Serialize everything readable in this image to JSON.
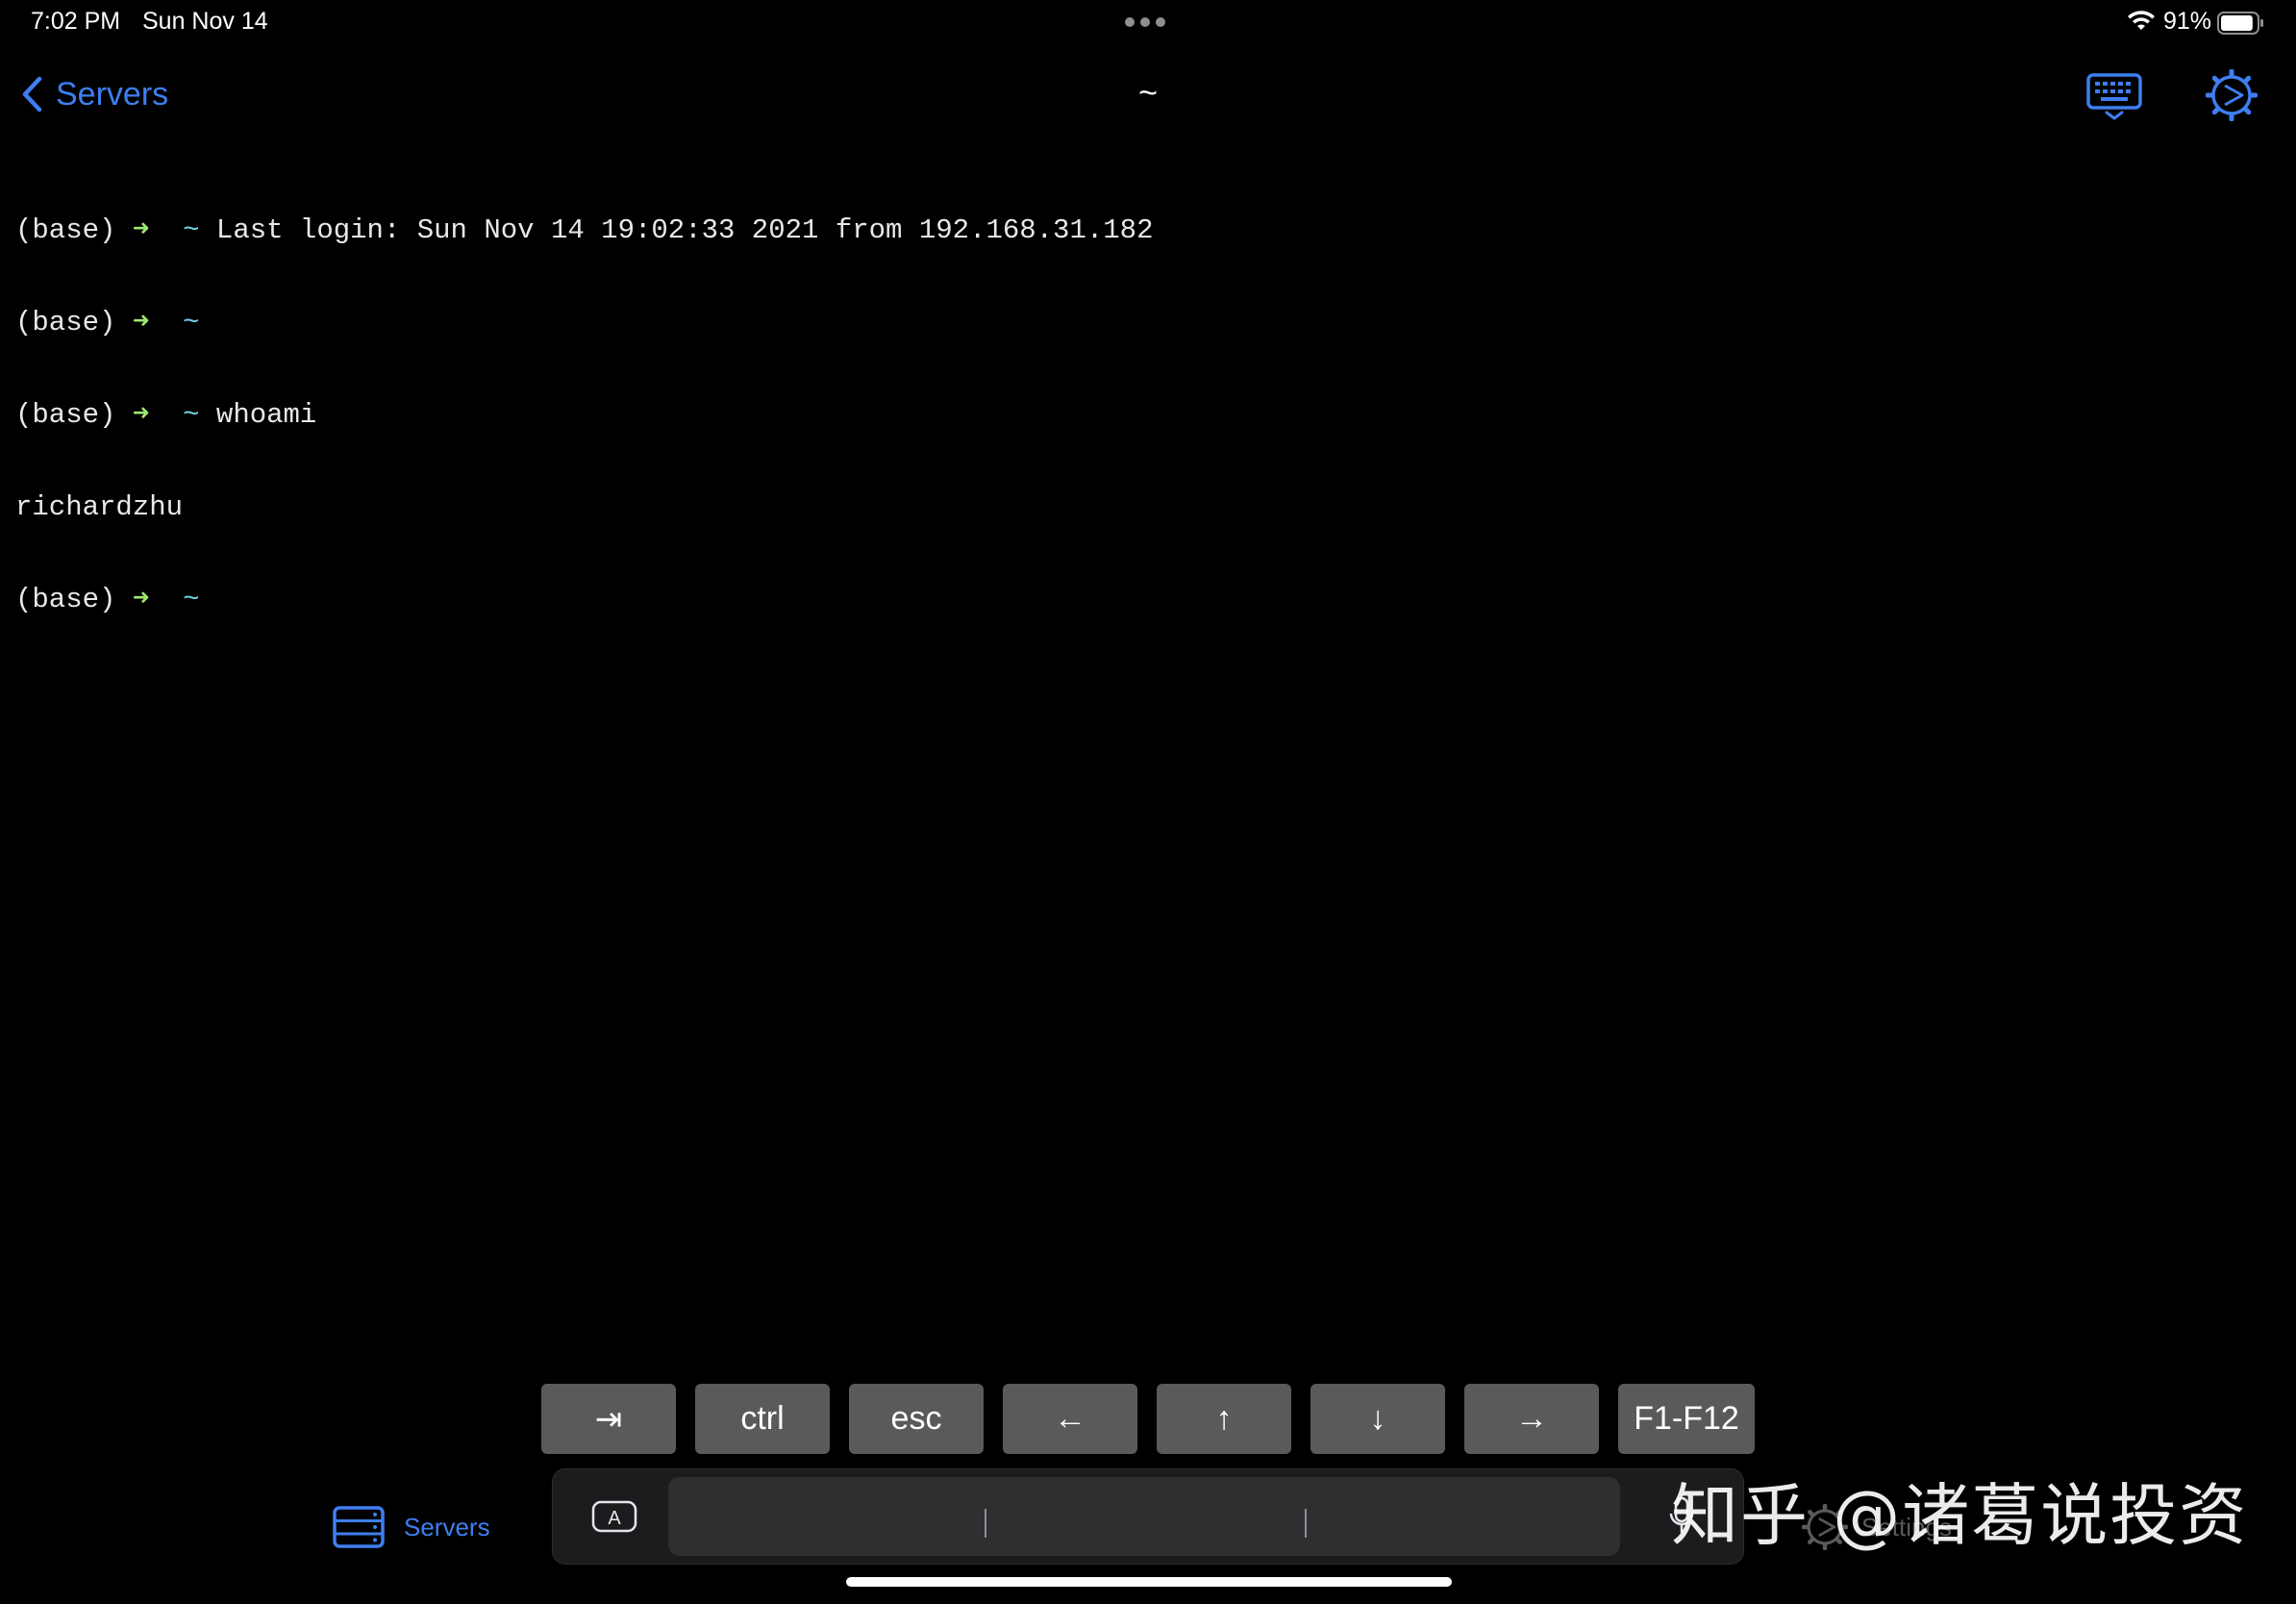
{
  "status_bar": {
    "time": "7:02 PM",
    "date": "Sun Nov 14",
    "battery_percent": "91%",
    "battery_level": 0.91,
    "wifi_icon": "wifi-icon",
    "battery_icon": "battery-icon"
  },
  "nav": {
    "back_label": "Servers",
    "back_icon": "chevron-left-icon",
    "title": "~",
    "keyboard_icon": "keyboard-icon",
    "settings_icon": "settings-gear-icon",
    "accent_color": "#3d7ff0"
  },
  "terminal": {
    "lines": [
      {
        "prefix": "(base)",
        "arrow": "➜",
        "tilde": "~",
        "text": " Last login: Sun Nov 14 19:02:33 2021 from 192.168.31.182"
      },
      {
        "prefix": "(base)",
        "arrow": "➜",
        "tilde": "~",
        "text": ""
      },
      {
        "prefix": "(base)",
        "arrow": "➜",
        "tilde": "~",
        "text": " whoami"
      },
      {
        "output": "richardzhu"
      },
      {
        "prefix": "(base)",
        "arrow": "➜",
        "tilde": "~",
        "text": ""
      }
    ],
    "prompt_arrow_color": "#9ee86e",
    "prompt_tilde_color": "#6fd3e6"
  },
  "accessory_keys": [
    {
      "label": "⇥",
      "name": "tab-key"
    },
    {
      "label": "ctrl",
      "name": "ctrl-key"
    },
    {
      "label": "esc",
      "name": "esc-key"
    },
    {
      "label": "←",
      "name": "arrow-left-key"
    },
    {
      "label": "↑",
      "name": "arrow-up-key"
    },
    {
      "label": "↓",
      "name": "arrow-down-key"
    },
    {
      "label": "→",
      "name": "arrow-right-key"
    },
    {
      "label": "F1-F12",
      "name": "function-keys-key"
    }
  ],
  "input_bar": {
    "a_icon": "keyboard-a-icon",
    "mic_icon": "microphone-icon"
  },
  "tab_bar": {
    "servers_label": "Servers",
    "servers_icon": "servers-icon",
    "settings_label": "Settings",
    "settings_icon": "settings-gear-icon"
  },
  "watermark": "知乎 @诸葛说投资"
}
